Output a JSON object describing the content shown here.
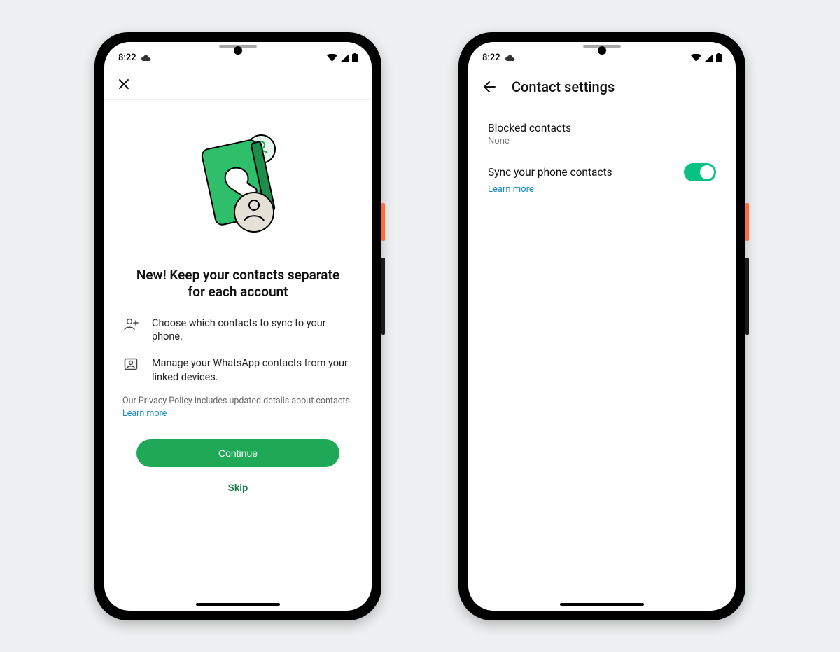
{
  "status": {
    "time": "8:22"
  },
  "screen1": {
    "title": "New! Keep your contacts separate for each account",
    "bullets": {
      "b1": "Choose which contacts to sync to your phone.",
      "b2": "Manage your WhatsApp contacts from your linked devices."
    },
    "policy_text": "Our Privacy Policy includes updated details about contacts. ",
    "policy_link": "Learn more",
    "cta": "Continue",
    "skip": "Skip"
  },
  "screen2": {
    "title": "Contact settings",
    "blocked_label": "Blocked contacts",
    "blocked_value": "None",
    "sync_label": "Sync your phone contacts",
    "sync_link": "Learn more"
  }
}
